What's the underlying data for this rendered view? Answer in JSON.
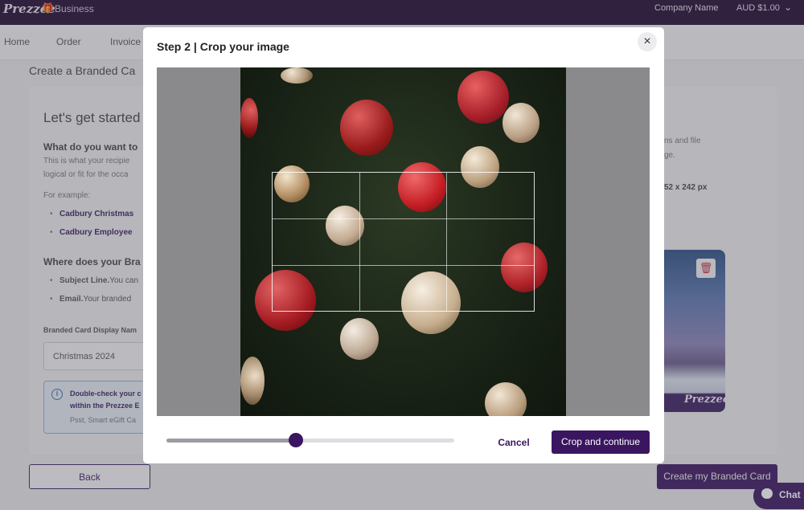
{
  "topbar": {
    "logo": "Prezzee",
    "logo_sub": "Business",
    "company": "Company Name",
    "balance": "AUD $1.00"
  },
  "nav": {
    "items": [
      "Home",
      "Order",
      "Invoice"
    ]
  },
  "page": {
    "title": "Create a Branded Ca",
    "left": {
      "heading": "Let's get started",
      "q1": "What do you want to",
      "p1a": "This is what your recipie",
      "p1b": "logical or fit for the occa",
      "example_label": "For example:",
      "links": [
        "Cadbury Christmas",
        "Cadbury Employee"
      ],
      "q2": "Where does your Bra",
      "bullets": [
        {
          "bold": "Subject Line.",
          "text": "You can"
        },
        {
          "bold": "Email.",
          "text": "Your branded"
        }
      ],
      "field_label": "Branded Card Display Nam",
      "field_value": "Christmas 2024",
      "info_line1": "Double-check your c",
      "info_line2": "within the Prezzee E",
      "info_sub": "Psst, Smart eGift Ca"
    },
    "right": {
      "line1": "ns and file",
      "line2": "ge.",
      "dims": "52 x 242 px",
      "preview_logo": "Prezzee"
    },
    "back_label": "Back",
    "create_label": "Create my Branded Card",
    "chat_label": "Chat"
  },
  "modal": {
    "title": "Step 2 | Crop your image",
    "close": "×",
    "cancel_label": "Cancel",
    "crop_label": "Crop and continue",
    "zoom": 0.45
  },
  "colors": {
    "brand": "#3a1560",
    "topbar": "#1f0a32",
    "danger": "#c8283a"
  }
}
